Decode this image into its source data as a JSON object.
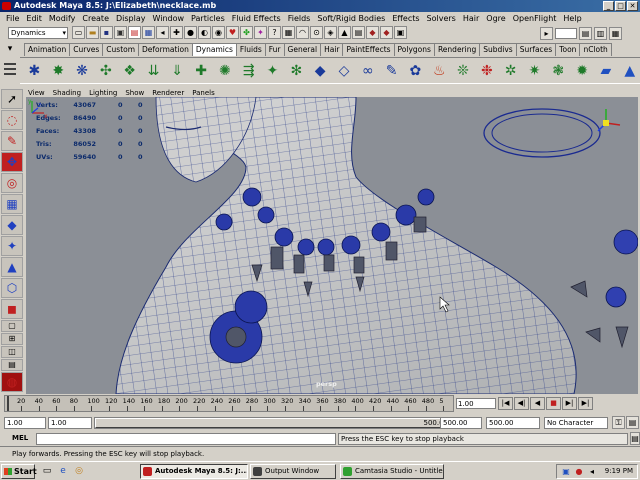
{
  "window": {
    "title": "Autodesk Maya 8.5: J:\\Elizabeth\\necklace.mb",
    "controls": [
      "_",
      "□",
      "✕"
    ]
  },
  "menu": [
    "File",
    "Edit",
    "Modify",
    "Create",
    "Display",
    "Window",
    "Particles",
    "Fluid Effects",
    "Fields",
    "Soft/Rigid Bodies",
    "Effects",
    "Solvers",
    "Hair",
    "Ogre",
    "OpenFlight",
    "Help"
  ],
  "status_line": {
    "menu_set": "Dynamics"
  },
  "shelf_tabs": [
    "Animation",
    "Curves",
    "Custom",
    "Deformation",
    "Dynamics",
    "Fluids",
    "Fur",
    "General",
    "Hair",
    "PaintEffects",
    "Polygons",
    "Rendering",
    "Subdivs",
    "Surfaces",
    "Toon",
    "nCloth"
  ],
  "active_shelf_tab": "Dynamics",
  "shelf_icons": [
    {
      "name": "particle-tool-icon",
      "glyph": "✱",
      "color": "#1a3a9a"
    },
    {
      "name": "emitter-icon",
      "glyph": "✸",
      "color": "#1f7a2a"
    },
    {
      "name": "omni-emitter-icon",
      "glyph": "❋",
      "color": "#1a3a9a"
    },
    {
      "name": "air-field-icon",
      "glyph": "✣",
      "color": "#1f7a2a"
    },
    {
      "name": "drag-field-icon",
      "glyph": "❖",
      "color": "#1f7a2a"
    },
    {
      "name": "gravity-field-icon",
      "glyph": "⇊",
      "color": "#1f7a2a"
    },
    {
      "name": "newton-field-icon",
      "glyph": "⇓",
      "color": "#1f7a2a"
    },
    {
      "name": "radial-field-icon",
      "glyph": "✚",
      "color": "#1f7a2a"
    },
    {
      "name": "turbulence-field-icon",
      "glyph": "✺",
      "color": "#1f7a2a"
    },
    {
      "name": "uniform-field-icon",
      "glyph": "⇶",
      "color": "#1f7a2a"
    },
    {
      "name": "vortex-field-icon",
      "glyph": "✦",
      "color": "#1f7a2a"
    },
    {
      "name": "volume-axis-icon",
      "glyph": "✻",
      "color": "#1f7a2a"
    },
    {
      "name": "rigid-body-icon",
      "glyph": "◆",
      "color": "#1a3a9a"
    },
    {
      "name": "passive-body-icon",
      "glyph": "◇",
      "color": "#1a3a9a"
    },
    {
      "name": "constraint-icon",
      "glyph": "∞",
      "color": "#1a3a9a"
    },
    {
      "name": "nail-constraint-icon",
      "glyph": "✎",
      "color": "#1a3a9a"
    },
    {
      "name": "soft-body-icon",
      "glyph": "✿",
      "color": "#1a3a9a"
    },
    {
      "name": "fire-effect-icon",
      "glyph": "♨",
      "color": "#c03010"
    },
    {
      "name": "smoke-effect-icon",
      "glyph": "❊",
      "color": "#1f7a2a"
    },
    {
      "name": "fireworks-effect-icon",
      "glyph": "❉",
      "color": "#c02020"
    },
    {
      "name": "lightning-effect-icon",
      "glyph": "✲",
      "color": "#1f7a2a"
    },
    {
      "name": "shatter-effect-icon",
      "glyph": "✷",
      "color": "#1f7a2a"
    },
    {
      "name": "curve-flow-icon",
      "glyph": "❃",
      "color": "#1f7a2a"
    },
    {
      "name": "surface-flow-icon",
      "glyph": "✹",
      "color": "#1f7a2a"
    },
    {
      "name": "fluid-container-icon",
      "glyph": "▰",
      "color": "#2050c0"
    },
    {
      "name": "fluid-emitter-icon",
      "glyph": "▲",
      "color": "#2050c0"
    }
  ],
  "panel_menu": [
    "View",
    "Shading",
    "Lighting",
    "Show",
    "Renderer",
    "Panels"
  ],
  "hud": [
    {
      "label": "Verts:",
      "value": "43067",
      "a": "0",
      "b": "0"
    },
    {
      "label": "Edges:",
      "value": "86490",
      "a": "0",
      "b": "0"
    },
    {
      "label": "Faces:",
      "value": "43308",
      "a": "0",
      "b": "0"
    },
    {
      "label": "Tris:",
      "value": "86052",
      "a": "0",
      "b": "0"
    },
    {
      "label": "UVs:",
      "value": "59640",
      "a": "0",
      "b": "0"
    }
  ],
  "camera": "persp",
  "axis_labels": {
    "x": "x",
    "y": "y",
    "z": "z"
  },
  "time_slider": {
    "ticks": [
      "20",
      "40",
      "60",
      "80",
      "100",
      "120",
      "140",
      "160",
      "180",
      "200",
      "220",
      "240",
      "260",
      "280",
      "300",
      "320",
      "340",
      "360",
      "380",
      "400",
      "420",
      "440",
      "460",
      "480",
      "5"
    ],
    "current_frame": "1.00",
    "playback_buttons": [
      "|◀",
      "◀|",
      "◀",
      "■",
      "▶|",
      "▶|"
    ]
  },
  "range": {
    "start_time": "1.00",
    "playback_start": "1.00",
    "playback_end_label": "500.00",
    "playback_end": "500.00",
    "end_time": "500.00",
    "character_set": "No Character Set"
  },
  "command_line": {
    "label": "MEL",
    "result": "Press the ESC key to stop playback"
  },
  "help_line": "Play forwards. Pressing the ESC key will stop playback.",
  "taskbar": {
    "start": "Start",
    "buttons": [
      {
        "label": "Autodesk Maya 8.5: J:...",
        "active": true
      },
      {
        "label": "Output Window",
        "active": false
      },
      {
        "label": "Camtasia Studio - Untitle...",
        "active": false
      }
    ],
    "clock": "9:19 PM"
  }
}
